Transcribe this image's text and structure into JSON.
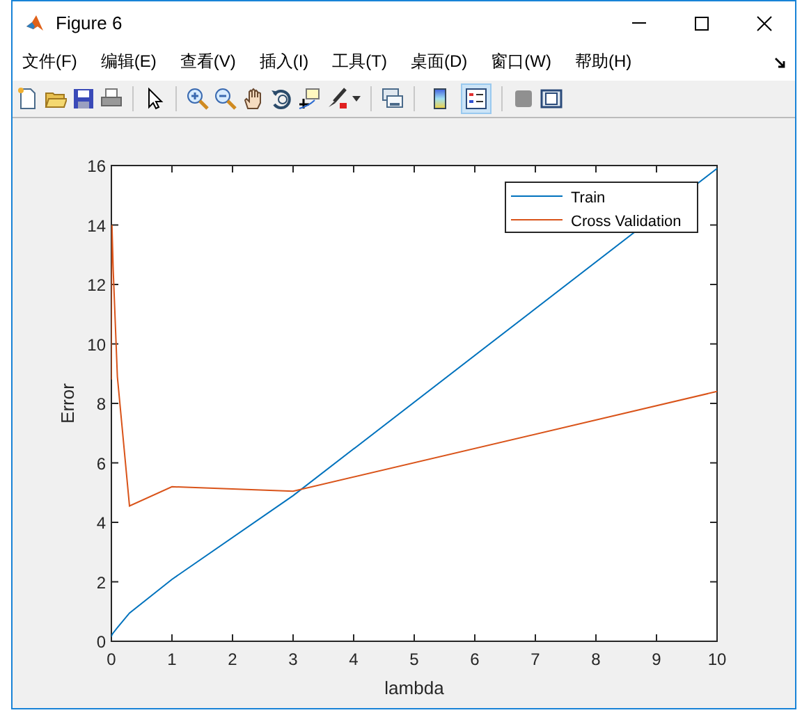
{
  "window": {
    "title": "Figure 6"
  },
  "menu": [
    {
      "label": "文件(F)"
    },
    {
      "label": "编辑(E)"
    },
    {
      "label": "查看(V)"
    },
    {
      "label": "插入(I)"
    },
    {
      "label": "工具(T)"
    },
    {
      "label": "桌面(D)"
    },
    {
      "label": "窗口(W)"
    },
    {
      "label": "帮助(H)"
    }
  ],
  "toolbar_toggles": [
    {
      "selected": false
    },
    {
      "selected": true
    }
  ],
  "figure": {
    "chart_data": {
      "type": "line",
      "xlabel": "lambda",
      "ylabel": "Error",
      "x": [
        0,
        0.001,
        0.003,
        0.01,
        0.03,
        0.1,
        0.3,
        1,
        3,
        10
      ],
      "series": [
        {
          "name": "Train",
          "color": "#0072bd",
          "values": [
            0.17,
            0.17,
            0.17,
            0.22,
            0.28,
            0.46,
            0.95,
            2.08,
            4.9,
            15.9
          ]
        },
        {
          "name": "Cross Validation",
          "color": "#d95319",
          "values": [
            8.8,
            10.5,
            12.5,
            14.0,
            12.5,
            8.9,
            4.55,
            5.2,
            5.05,
            8.4
          ]
        }
      ],
      "legend": true,
      "xlim": [
        0,
        10
      ],
      "ylim": [
        0,
        16
      ],
      "xticks": [
        0,
        1,
        2,
        3,
        4,
        5,
        6,
        7,
        8,
        9,
        10
      ],
      "yticks": [
        0,
        2,
        4,
        6,
        8,
        10,
        12,
        14,
        16
      ]
    }
  }
}
